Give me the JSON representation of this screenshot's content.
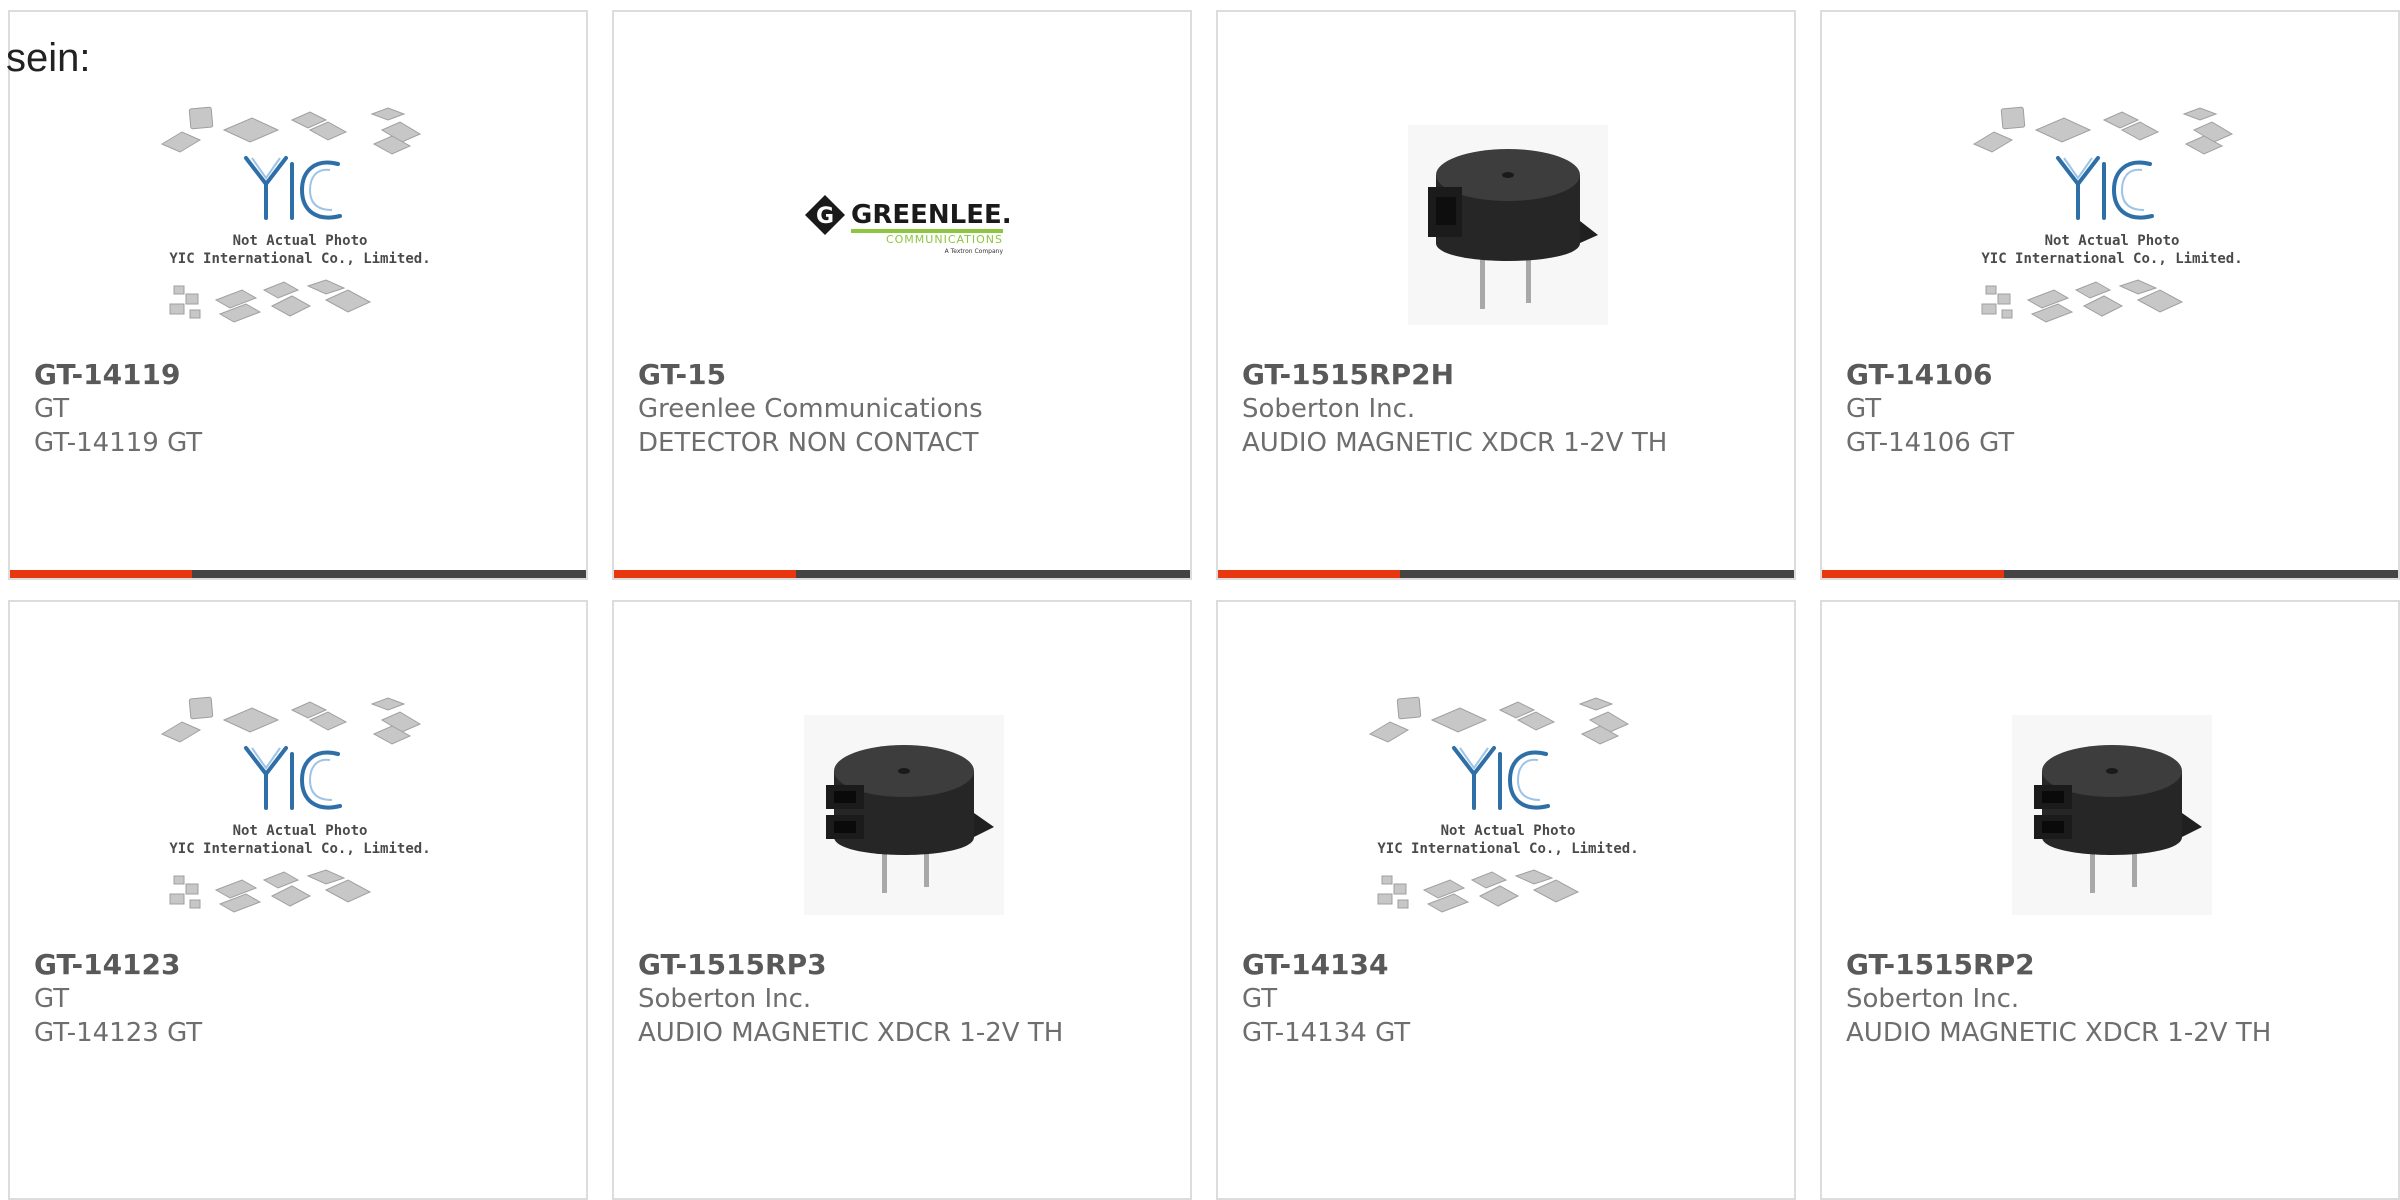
{
  "heading": "sein:",
  "placeholder": {
    "logo_text": "YIC",
    "line1": "Not Actual Photo",
    "line2": "YIC International Co., Limited."
  },
  "greenlee_logo": {
    "letter": "G",
    "name": "GREENLEE.",
    "sub": "COMMUNICATIONS",
    "tagline": "A Textron Company"
  },
  "colors": {
    "accent": "#e8360f",
    "bar": "#444444",
    "border": "#dcdcdc",
    "greenlee_green": "#8dc63f"
  },
  "products": [
    {
      "part": "GT-14119",
      "manufacturer": "GT",
      "description": "GT-14119 GT",
      "image": "yic-placeholder"
    },
    {
      "part": "GT-15",
      "manufacturer": "Greenlee Communications",
      "description": "DETECTOR NON CONTACT",
      "image": "greenlee-logo"
    },
    {
      "part": "GT-1515RP2H",
      "manufacturer": "Soberton Inc.",
      "description": "AUDIO MAGNETIC XDCR 1-2V TH",
      "image": "buzzer-single-slot"
    },
    {
      "part": "GT-14106",
      "manufacturer": "GT",
      "description": "GT-14106 GT",
      "image": "yic-placeholder"
    },
    {
      "part": "GT-14123",
      "manufacturer": "GT",
      "description": "GT-14123 GT",
      "image": "yic-placeholder"
    },
    {
      "part": "GT-1515RP3",
      "manufacturer": "Soberton Inc.",
      "description": "AUDIO MAGNETIC XDCR 1-2V TH",
      "image": "buzzer-double-slot"
    },
    {
      "part": "GT-14134",
      "manufacturer": "GT",
      "description": "GT-14134 GT",
      "image": "yic-placeholder"
    },
    {
      "part": "GT-1515RP2",
      "manufacturer": "Soberton Inc.",
      "description": "AUDIO MAGNETIC XDCR 1-2V TH",
      "image": "buzzer-double-slot"
    }
  ]
}
